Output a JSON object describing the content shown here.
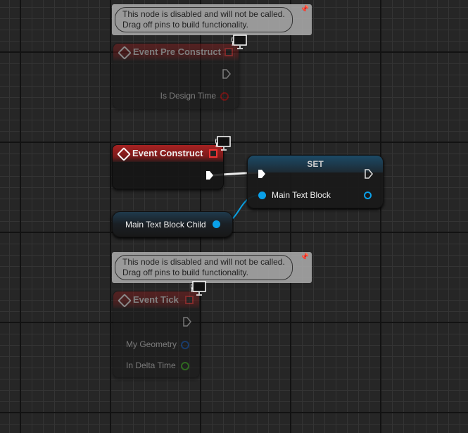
{
  "nodes": {
    "pre_construct": {
      "title": "Event Pre Construct",
      "pins": [
        "Is Design Time"
      ],
      "comment": "This node is disabled and will not be called.\nDrag off pins to build functionality."
    },
    "construct": {
      "title": "Event Construct"
    },
    "set": {
      "title": "SET",
      "pins": [
        "Main Text Block"
      ]
    },
    "getter": {
      "label": "Main Text Block Child"
    },
    "tick": {
      "title": "Event Tick",
      "pins": [
        "My Geometry",
        "In Delta Time"
      ],
      "comment": "This node is disabled and will not be called.\nDrag off pins to build functionality."
    }
  },
  "colors": {
    "event_header": "#8e1e1e",
    "object_pin": "#00a0e8",
    "struct_pin": "#0a56c0",
    "float_pin": "#3cba1a",
    "bool_pin": "#a00000"
  }
}
